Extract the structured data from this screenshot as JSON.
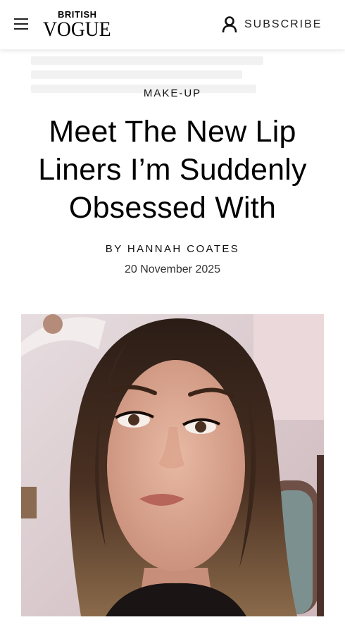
{
  "header": {
    "brand_top": "BRITISH",
    "brand_main": "VOGUE",
    "subscribe_label": "SUBSCRIBE"
  },
  "article": {
    "category": "MAKE-UP",
    "headline_lines": [
      "Meet The New Lip",
      "Liners I’m Suddenly",
      "Obsessed With"
    ],
    "byline_prefix": "BY",
    "author": "HANNAH COATES",
    "date": "20 November 2025"
  },
  "icons": {
    "menu": "hamburger-menu-icon",
    "account": "user-icon"
  },
  "colors": {
    "text": "#000000",
    "background": "#ffffff"
  }
}
